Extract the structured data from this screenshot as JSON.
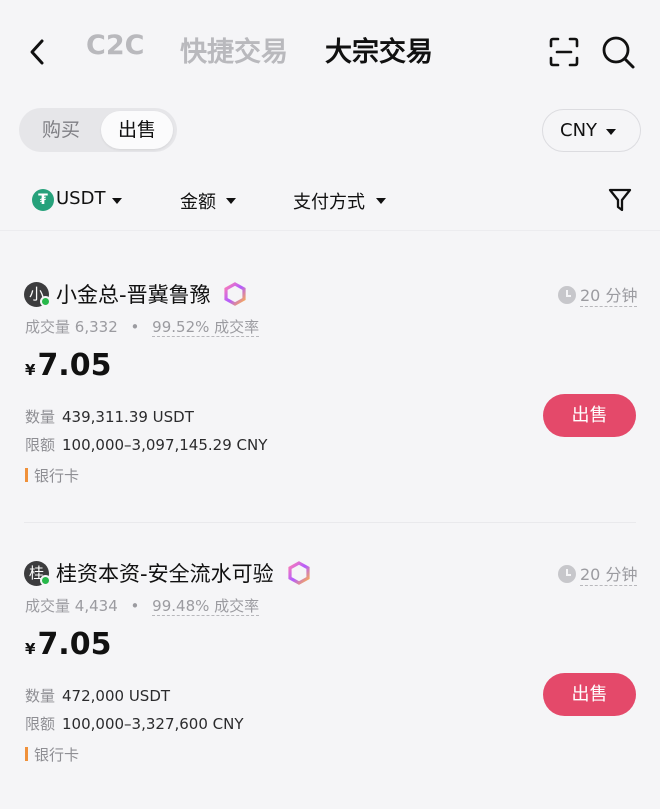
{
  "header": {
    "tabs": [
      "C2C",
      "快捷交易",
      "大宗交易"
    ],
    "active_tab": 2
  },
  "trade_side": {
    "buy_label": "购买",
    "sell_label": "出售",
    "selected": "出售"
  },
  "currency": {
    "selected": "CNY"
  },
  "filters": {
    "coin": "USDT",
    "amount": "金额",
    "payment": "支付方式"
  },
  "listings": [
    {
      "avatar_char": "小",
      "name": "小金总-晋冀鲁豫",
      "time": "20 分钟",
      "volume_label": "成交量",
      "volume": "6,332",
      "completion": "99.52% 成交率",
      "currency_symbol": "¥",
      "price": "7.05",
      "qty_label": "数量",
      "qty": "439,311.39 USDT",
      "limit_label": "限额",
      "limit": "100,000–3,097,145.29 CNY",
      "payment": "银行卡",
      "action": "出售"
    },
    {
      "avatar_char": "桂",
      "name": "桂资本资-安全流水可验",
      "time": "20 分钟",
      "volume_label": "成交量",
      "volume": "4,434",
      "completion": "99.48% 成交率",
      "currency_symbol": "¥",
      "price": "7.05",
      "qty_label": "数量",
      "qty": "472,000 USDT",
      "limit_label": "限额",
      "limit": "100,000–3,327,600 CNY",
      "payment": "银行卡",
      "action": "出售"
    }
  ],
  "colors": {
    "accent_sell": "#e4496a",
    "tether_green": "#26a17b",
    "online_green": "#27b84a",
    "payment_bar": "#f0913a"
  }
}
